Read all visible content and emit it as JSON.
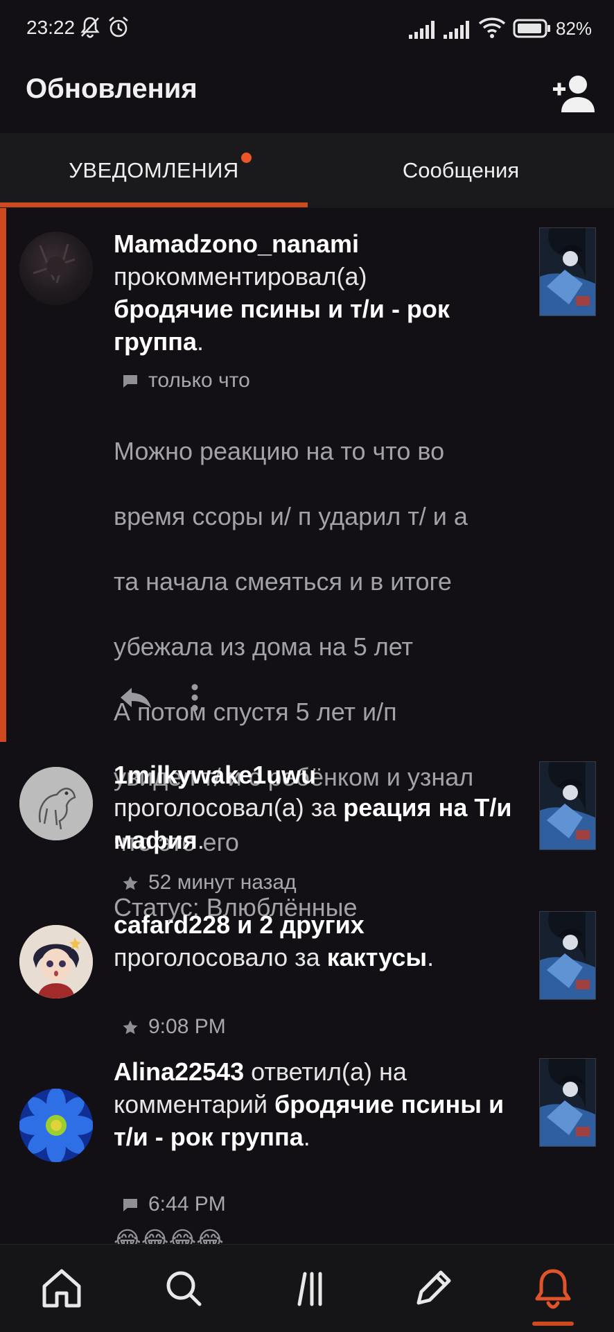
{
  "status_bar": {
    "time": "23:22",
    "battery": "82%",
    "icons": [
      "bell-off-icon",
      "alarm-icon",
      "signal-icon",
      "signal-icon",
      "wifi-icon",
      "battery-icon"
    ]
  },
  "header": {
    "title": "Обновления",
    "action_icon": "add-user-icon"
  },
  "tabs": [
    {
      "label": "УВЕДОМЛЕНИЯ",
      "active": true,
      "has_dot": true
    },
    {
      "label": "Сообщения",
      "active": false
    }
  ],
  "colors": {
    "accent": "#cc4a1e",
    "background": "#121014"
  },
  "notifications": [
    {
      "user": "Mamadzono_nanami",
      "action": "прокомментировал(а)",
      "target": "бродячие псины и т/и - рок группа",
      "end": ".",
      "icon": "comment-icon",
      "time": "только что",
      "comment_lines": [
        "Можно реакцию на то что во",
        "время ссоры и/ п ударил т/ и  а",
        "та начала смеяться  и в итоге",
        "убежала из дома на 5 лет",
        "А потом спустя 5 лет и/п",
        "увидел т/ и с ребёнком и узнал",
        "что это его",
        "Статус: Влюблённые"
      ],
      "actions": [
        "reply-icon",
        "more-options-icon"
      ]
    },
    {
      "user": "1milkywake1uwu",
      "action": "проголосовал(а) за",
      "target": "реация на Т/и мафия",
      "end": ".",
      "icon": "star-icon",
      "time": "52 минут назад"
    },
    {
      "user": "cafard228 и 2 других",
      "action": "проголосовало за",
      "target": "кактусы",
      "end": ".",
      "icon": "star-icon",
      "time": "9:08 PM"
    },
    {
      "user": "Alina22543",
      "action": "ответил(а) на комментарий",
      "target": "бродячие псины и т/и - рок группа",
      "end": ".",
      "icon": "comment-icon",
      "time": "6:44 PM",
      "emoji_preview": "😂😂😂😂"
    }
  ],
  "bottom_nav": [
    {
      "name": "home-icon",
      "active": false
    },
    {
      "name": "search-icon",
      "active": false
    },
    {
      "name": "library-icon",
      "active": false
    },
    {
      "name": "write-icon",
      "active": false
    },
    {
      "name": "notifications-bell-icon",
      "active": true
    }
  ]
}
